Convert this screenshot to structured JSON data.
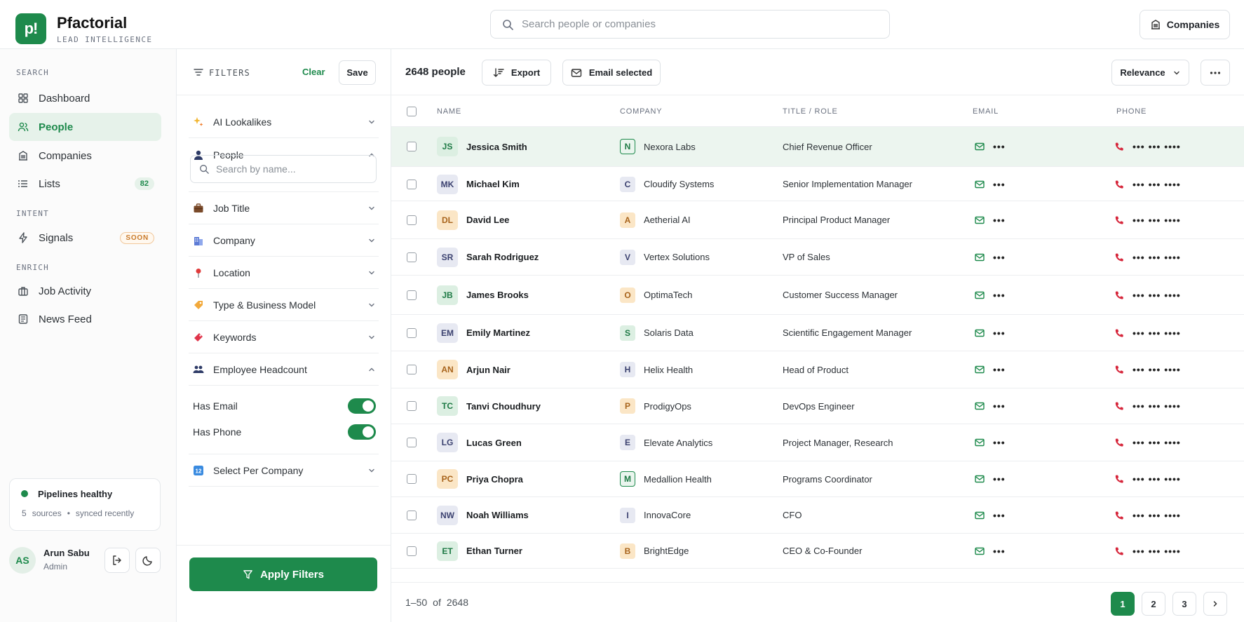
{
  "brand": {
    "logo_text": "p!",
    "name": "Pfactorial",
    "tagline": "LEAD INTELLIGENCE"
  },
  "header": {
    "search_placeholder": "Search people or companies",
    "companies_label": "Companies"
  },
  "sidebar": {
    "sections": [
      {
        "label": "SEARCH",
        "items": [
          {
            "label": "Dashboard",
            "icon": "grid-icon"
          },
          {
            "label": "People",
            "icon": "users-icon",
            "active": true
          },
          {
            "label": "Companies",
            "icon": "building-icon"
          },
          {
            "label": "Lists",
            "icon": "list-icon",
            "count": "82"
          }
        ]
      },
      {
        "label": "INTENT",
        "items": [
          {
            "label": "Signals",
            "icon": "bolt-icon",
            "badge": "SOON"
          }
        ]
      },
      {
        "label": "ENRICH",
        "items": [
          {
            "label": "Job Activity",
            "icon": "briefcase-icon"
          },
          {
            "label": "News Feed",
            "icon": "newspaper-icon"
          }
        ]
      }
    ],
    "health": {
      "title": "Pipelines healthy",
      "sources_count": "5",
      "sources_label": "sources",
      "separator": "•",
      "sync_status": "synced recently"
    },
    "user": {
      "initials": "AS",
      "name": "Arun Sabu",
      "role": "Admin"
    }
  },
  "filters": {
    "title": "FILTERS",
    "clear_label": "Clear",
    "save_label": "Save",
    "groups": [
      {
        "label": "AI Lookalikes",
        "icon": "sparkles-icon",
        "expanded": false
      },
      {
        "label": "People",
        "icon": "person-icon",
        "expanded": true
      },
      {
        "label": "Job Title",
        "icon": "briefcase-icon",
        "expanded": false
      },
      {
        "label": "Company",
        "icon": "office-icon",
        "expanded": false
      },
      {
        "label": "Location",
        "icon": "pin-icon",
        "expanded": false
      },
      {
        "label": "Type & Business Model",
        "icon": "tag-icon",
        "expanded": false
      },
      {
        "label": "Keywords",
        "icon": "ticket-icon",
        "expanded": false
      },
      {
        "label": "Employee Headcount",
        "icon": "people-icon",
        "expanded": true
      },
      {
        "label": "Select Per Company",
        "icon": "numbers-icon",
        "expanded": false
      }
    ],
    "name_search_placeholder": "Search by name...",
    "toggles": [
      {
        "label": "Has Email",
        "on": true
      },
      {
        "label": "Has Phone",
        "on": true
      }
    ],
    "apply_label": "Apply Filters"
  },
  "results": {
    "count_label": "2648 people",
    "export_label": "Export",
    "email_selected_label": "Email selected",
    "sort_label": "Relevance",
    "columns": [
      "NAME",
      "COMPANY",
      "TITLE / ROLE",
      "EMAIL",
      "PHONE"
    ],
    "email_masked": "•••",
    "phone_masked": "••• ••• ••••",
    "rows": [
      {
        "initials": "JS",
        "name": "Jessica Smith",
        "avatar_color": "green",
        "company_initial": "N",
        "company": "Nexora Labs",
        "company_color": "bgreen",
        "title": "Chief Revenue Officer",
        "selected": true
      },
      {
        "initials": "MK",
        "name": "Michael Kim",
        "avatar_color": "slate",
        "company_initial": "C",
        "company": "Cloudify Systems",
        "company_color": "slate",
        "title": "Senior Implementation Manager"
      },
      {
        "initials": "DL",
        "name": "David Lee",
        "avatar_color": "amber",
        "company_initial": "A",
        "company": "Aetherial AI",
        "company_color": "amber",
        "title": "Principal Product Manager"
      },
      {
        "initials": "SR",
        "name": "Sarah Rodriguez",
        "avatar_color": "slate",
        "company_initial": "V",
        "company": "Vertex Solutions",
        "company_color": "slate",
        "title": "VP of Sales"
      },
      {
        "initials": "JB",
        "name": "James Brooks",
        "avatar_color": "green",
        "company_initial": "O",
        "company": "OptimaTech",
        "company_color": "amber",
        "title": "Customer Success Manager"
      },
      {
        "initials": "EM",
        "name": "Emily Martinez",
        "avatar_color": "slate",
        "company_initial": "S",
        "company": "Solaris Data",
        "company_color": "green",
        "title": "Scientific Engagement Manager"
      },
      {
        "initials": "AN",
        "name": "Arjun Nair",
        "avatar_color": "amber",
        "company_initial": "H",
        "company": "Helix Health",
        "company_color": "slate",
        "title": "Head of Product"
      },
      {
        "initials": "TC",
        "name": "Tanvi Choudhury",
        "avatar_color": "green",
        "company_initial": "P",
        "company": "ProdigyOps",
        "company_color": "amber",
        "title": "DevOps Engineer"
      },
      {
        "initials": "LG",
        "name": "Lucas Green",
        "avatar_color": "slate",
        "company_initial": "E",
        "company": "Elevate Analytics",
        "company_color": "slate",
        "title": "Project Manager, Research"
      },
      {
        "initials": "PC",
        "name": "Priya Chopra",
        "avatar_color": "amber",
        "company_initial": "M",
        "company": "Medallion Health",
        "company_color": "bgreen",
        "title": "Programs Coordinator"
      },
      {
        "initials": "NW",
        "name": "Noah Williams",
        "avatar_color": "slate",
        "company_initial": "I",
        "company": "InnovaCore",
        "company_color": "slate",
        "title": "CFO"
      },
      {
        "initials": "ET",
        "name": "Ethan Turner",
        "avatar_color": "green",
        "company_initial": "B",
        "company": "BrightEdge",
        "company_color": "amber",
        "title": "CEO & Co-Founder"
      }
    ],
    "pagination": {
      "range": "1–50",
      "of_label": "of",
      "total": "2648",
      "pages": [
        "1",
        "2",
        "3"
      ],
      "current": "1"
    }
  },
  "colors": {
    "accent": "#1e8a4c",
    "phone_icon": "#d6263b"
  }
}
